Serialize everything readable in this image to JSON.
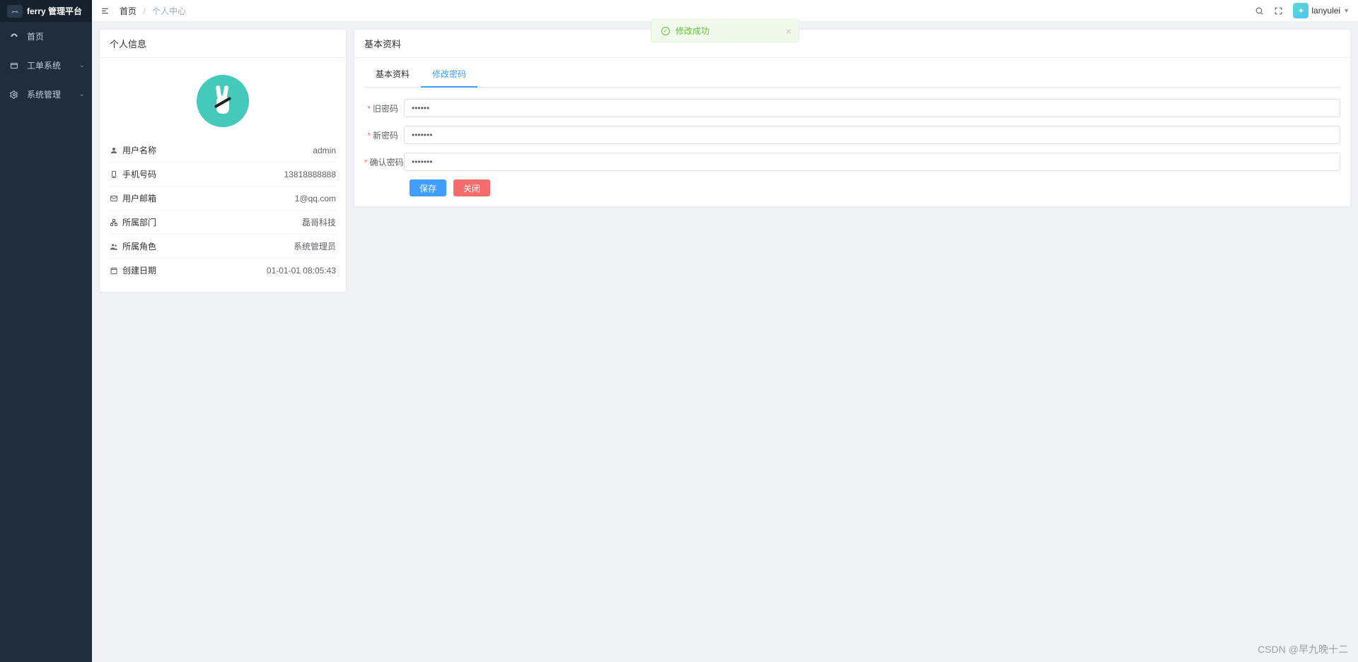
{
  "brand": "ferry 管理平台",
  "sidebar": {
    "items": [
      {
        "label": "首页"
      },
      {
        "label": "工单系统",
        "expandable": true
      },
      {
        "label": "系统管理",
        "expandable": true
      }
    ]
  },
  "breadcrumb": {
    "home": "首页",
    "current": "个人中心"
  },
  "header": {
    "username": "lanyulei"
  },
  "toast": {
    "message": "修改成功"
  },
  "profile": {
    "title": "个人信息",
    "rows": {
      "username": {
        "label": "用户名称",
        "value": "admin"
      },
      "phone": {
        "label": "手机号码",
        "value": "13818888888"
      },
      "email": {
        "label": "用户邮箱",
        "value": "1@qq.com"
      },
      "dept": {
        "label": "所属部门",
        "value": "磊哥科技"
      },
      "role": {
        "label": "所属角色",
        "value": "系统管理员"
      },
      "created": {
        "label": "创建日期",
        "value": "01-01-01 08:05:43"
      }
    }
  },
  "detail": {
    "title": "基本资料",
    "tabs": {
      "basic": "基本资料",
      "password": "修改密码"
    },
    "form": {
      "old_pwd_label": "旧密码",
      "new_pwd_label": "新密码",
      "confirm_pwd_label": "确认密码",
      "old_pwd_value": "••••••",
      "new_pwd_value": "•••••••",
      "confirm_pwd_value": "•••••••",
      "save": "保存",
      "close": "关闭"
    }
  },
  "watermark": "CSDN @早九晚十二"
}
